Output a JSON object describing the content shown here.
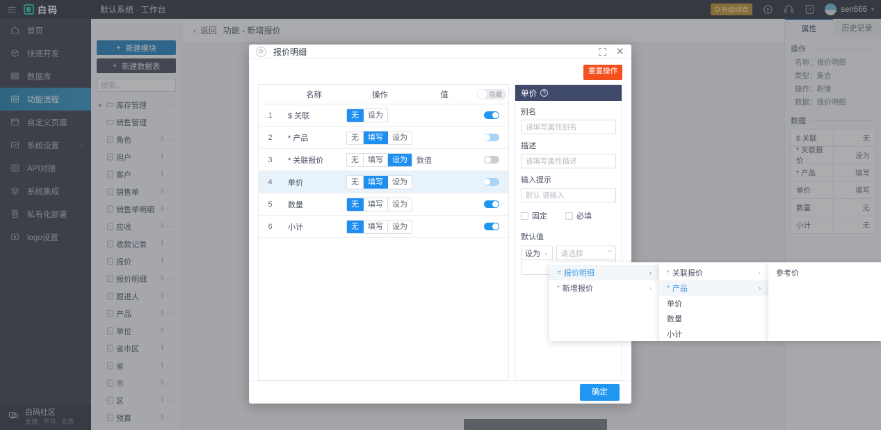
{
  "topbar": {
    "collapse_icon": "menu-collapse-icon",
    "logo_text": "白码",
    "system_label": "默认系统 · 工作台",
    "upgrade_badge": "升级/续费",
    "icons": [
      "play-circle-icon",
      "headset-icon",
      "help-square-icon"
    ],
    "username": "sen666",
    "caret": "▾"
  },
  "leftnav": {
    "items": [
      {
        "label": "首页",
        "icon": "home-icon",
        "active": false,
        "arrow": ""
      },
      {
        "label": "快速开发",
        "icon": "cube-icon",
        "active": false,
        "arrow": ""
      },
      {
        "label": "数据库",
        "icon": "database-icon",
        "active": false,
        "arrow": ""
      },
      {
        "label": "功能流程",
        "icon": "flow-icon",
        "active": true,
        "arrow": ""
      },
      {
        "label": "自定义页面",
        "icon": "page-icon",
        "active": false,
        "arrow": ""
      },
      {
        "label": "系统设置",
        "icon": "settings-icon",
        "active": false,
        "arrow": "›"
      },
      {
        "label": "API对接",
        "icon": "api-icon",
        "active": false,
        "arrow": ""
      },
      {
        "label": "系统集成",
        "icon": "layers-icon",
        "active": false,
        "arrow": ""
      },
      {
        "label": "私有化部署",
        "icon": "server-icon",
        "active": false,
        "arrow": ""
      },
      {
        "label": "logo设置",
        "icon": "logo-icon",
        "active": false,
        "arrow": ""
      }
    ],
    "footer": {
      "title": "白码社区",
      "subtitle": "反馈 · 学习 · 交流",
      "icon": "chat-icon"
    }
  },
  "col2": {
    "new_module_button": "新建模块",
    "new_table_button": "新建数据表",
    "plus": "+",
    "search_placeholder": "搜索...",
    "tree": [
      {
        "label": "库存管理",
        "icon": "folder-icon",
        "caret": "▶",
        "sliders": false
      },
      {
        "label": "销售管理",
        "icon": "folder-icon",
        "caret": "",
        "sliders": false
      },
      {
        "label": "角色",
        "icon": "table-icon",
        "caret": "",
        "sliders": true
      },
      {
        "label": "用户",
        "icon": "table-icon",
        "caret": "",
        "sliders": true
      },
      {
        "label": "客户",
        "icon": "table-icon",
        "caret": "",
        "sliders": true
      },
      {
        "label": "销售单",
        "icon": "table-icon",
        "caret": "",
        "sliders": true
      },
      {
        "label": "销售单明细",
        "icon": "table-icon",
        "caret": "",
        "sliders": true
      },
      {
        "label": "应收",
        "icon": "table-icon",
        "caret": "",
        "sliders": true
      },
      {
        "label": "收款记录",
        "icon": "table-icon",
        "caret": "",
        "sliders": true
      },
      {
        "label": "报价",
        "icon": "table-icon",
        "caret": "",
        "sliders": true
      },
      {
        "label": "报价明细",
        "icon": "table-icon",
        "caret": "",
        "sliders": true
      },
      {
        "label": "跟进人",
        "icon": "table-icon",
        "caret": "",
        "sliders": true
      },
      {
        "label": "产品",
        "icon": "table-icon",
        "caret": "",
        "sliders": true
      },
      {
        "label": "单位",
        "icon": "table-icon",
        "caret": "",
        "sliders": true
      },
      {
        "label": "省市区",
        "icon": "table-icon",
        "caret": "",
        "sliders": true
      },
      {
        "label": "省",
        "icon": "table-icon",
        "caret": "",
        "sliders": true
      },
      {
        "label": "市",
        "icon": "table-icon",
        "caret": "",
        "sliders": true
      },
      {
        "label": "区",
        "icon": "table-icon",
        "caret": "",
        "sliders": true
      },
      {
        "label": "预算",
        "icon": "table-icon",
        "caret": "",
        "sliders": true
      }
    ],
    "dots": "···",
    "sliders_glyph": "⦀"
  },
  "breadcrumb": {
    "back_label": "返回",
    "chevron": "‹",
    "title": "功能 - 新增报价"
  },
  "modal": {
    "title": "报价明细",
    "refresh_icon": "refresh-icon",
    "expand_icon": "expand-icon",
    "close_icon": "close-icon",
    "reset_button": "重置操作",
    "confirm_button": "确定",
    "table": {
      "headers": {
        "index": "",
        "name": "名称",
        "operation": "操作",
        "value": "值",
        "toggle": "隐藏"
      },
      "header_toggle_state": "off",
      "rows": [
        {
          "index": "1",
          "name": "$ 关联",
          "options": [
            "无",
            "设为"
          ],
          "selected": "无",
          "value": "",
          "toggle": "on",
          "highlight": false
        },
        {
          "index": "2",
          "name": "* 产品",
          "options": [
            "无",
            "填写",
            "设为"
          ],
          "selected": "填写",
          "value": "",
          "toggle": "dim",
          "highlight": false
        },
        {
          "index": "3",
          "name": "* 关联报价",
          "options": [
            "无",
            "填写",
            "设为"
          ],
          "selected": "设为",
          "value": "数值",
          "toggle": "off",
          "highlight": false
        },
        {
          "index": "4",
          "name": "单价",
          "options": [
            "无",
            "填写",
            "设为"
          ],
          "selected": "填写",
          "value": "",
          "toggle": "dim",
          "highlight": true
        },
        {
          "index": "5",
          "name": "数量",
          "options": [
            "无",
            "填写",
            "设为"
          ],
          "selected": "无",
          "value": "",
          "toggle": "on",
          "highlight": false
        },
        {
          "index": "6",
          "name": "小计",
          "options": [
            "无",
            "填写",
            "设为"
          ],
          "selected": "无",
          "value": "",
          "toggle": "on",
          "highlight": false
        }
      ]
    },
    "property": {
      "title": "单价",
      "help_icon": "question-icon",
      "alias_label": "别名",
      "alias_placeholder": "请填写属性别名",
      "desc_label": "描述",
      "desc_placeholder": "请填写属性描述",
      "hint_label": "输入提示",
      "hint_placeholder": "默认 请输入",
      "fixed_checkbox": "固定",
      "required_checkbox": "必填",
      "default_label": "默认值",
      "default_mode": "设为",
      "default_placeholder": "请选择",
      "mode_caret": "⌄",
      "select_caret": "⌃"
    }
  },
  "cascader": {
    "columns": [
      {
        "items": [
          {
            "prefix": "=",
            "label": "报价明细",
            "arrow": "›",
            "highlight": true
          },
          {
            "prefix": "*",
            "label": "新增报价",
            "arrow": "›",
            "highlight": false
          }
        ]
      },
      {
        "items": [
          {
            "prefix": "*",
            "label": "关联报价",
            "arrow": "›",
            "highlight": false
          },
          {
            "prefix": "*",
            "label": "产品",
            "arrow": "›",
            "highlight": true
          },
          {
            "prefix": "",
            "label": "单价",
            "arrow": "",
            "highlight": false
          },
          {
            "prefix": "",
            "label": "数量",
            "arrow": "",
            "highlight": false
          },
          {
            "prefix": "",
            "label": "小计",
            "arrow": "",
            "highlight": false
          }
        ]
      },
      {
        "items": [
          {
            "prefix": "",
            "label": "参考价",
            "arrow": "",
            "highlight": false
          }
        ]
      }
    ]
  },
  "rightpanel": {
    "tabs": [
      {
        "label": "属性",
        "active": true
      },
      {
        "label": "历史记录",
        "active": false
      }
    ],
    "operation_section": "操作",
    "operation_rows": [
      "名称：报价明细",
      "类型：集合",
      "操作：新增",
      "数据：报价明细"
    ],
    "data_section": "数据",
    "data_rows": [
      {
        "key": "$ 关联",
        "val": "无"
      },
      {
        "key": "* 关联报价",
        "val": "设为"
      },
      {
        "key": "* 产品",
        "val": "填写"
      },
      {
        "key": "单价",
        "val": "填写"
      },
      {
        "key": "数量",
        "val": "无"
      },
      {
        "key": "小计",
        "val": "无"
      }
    ]
  },
  "colors": {
    "accent_blue": "#1f96f0",
    "nav_active": "#2f93c2",
    "reset_red": "#f4501e",
    "prop_header": "#3f4a6b",
    "topbar": "#2b2f3a",
    "sidebar": "#353a45"
  }
}
